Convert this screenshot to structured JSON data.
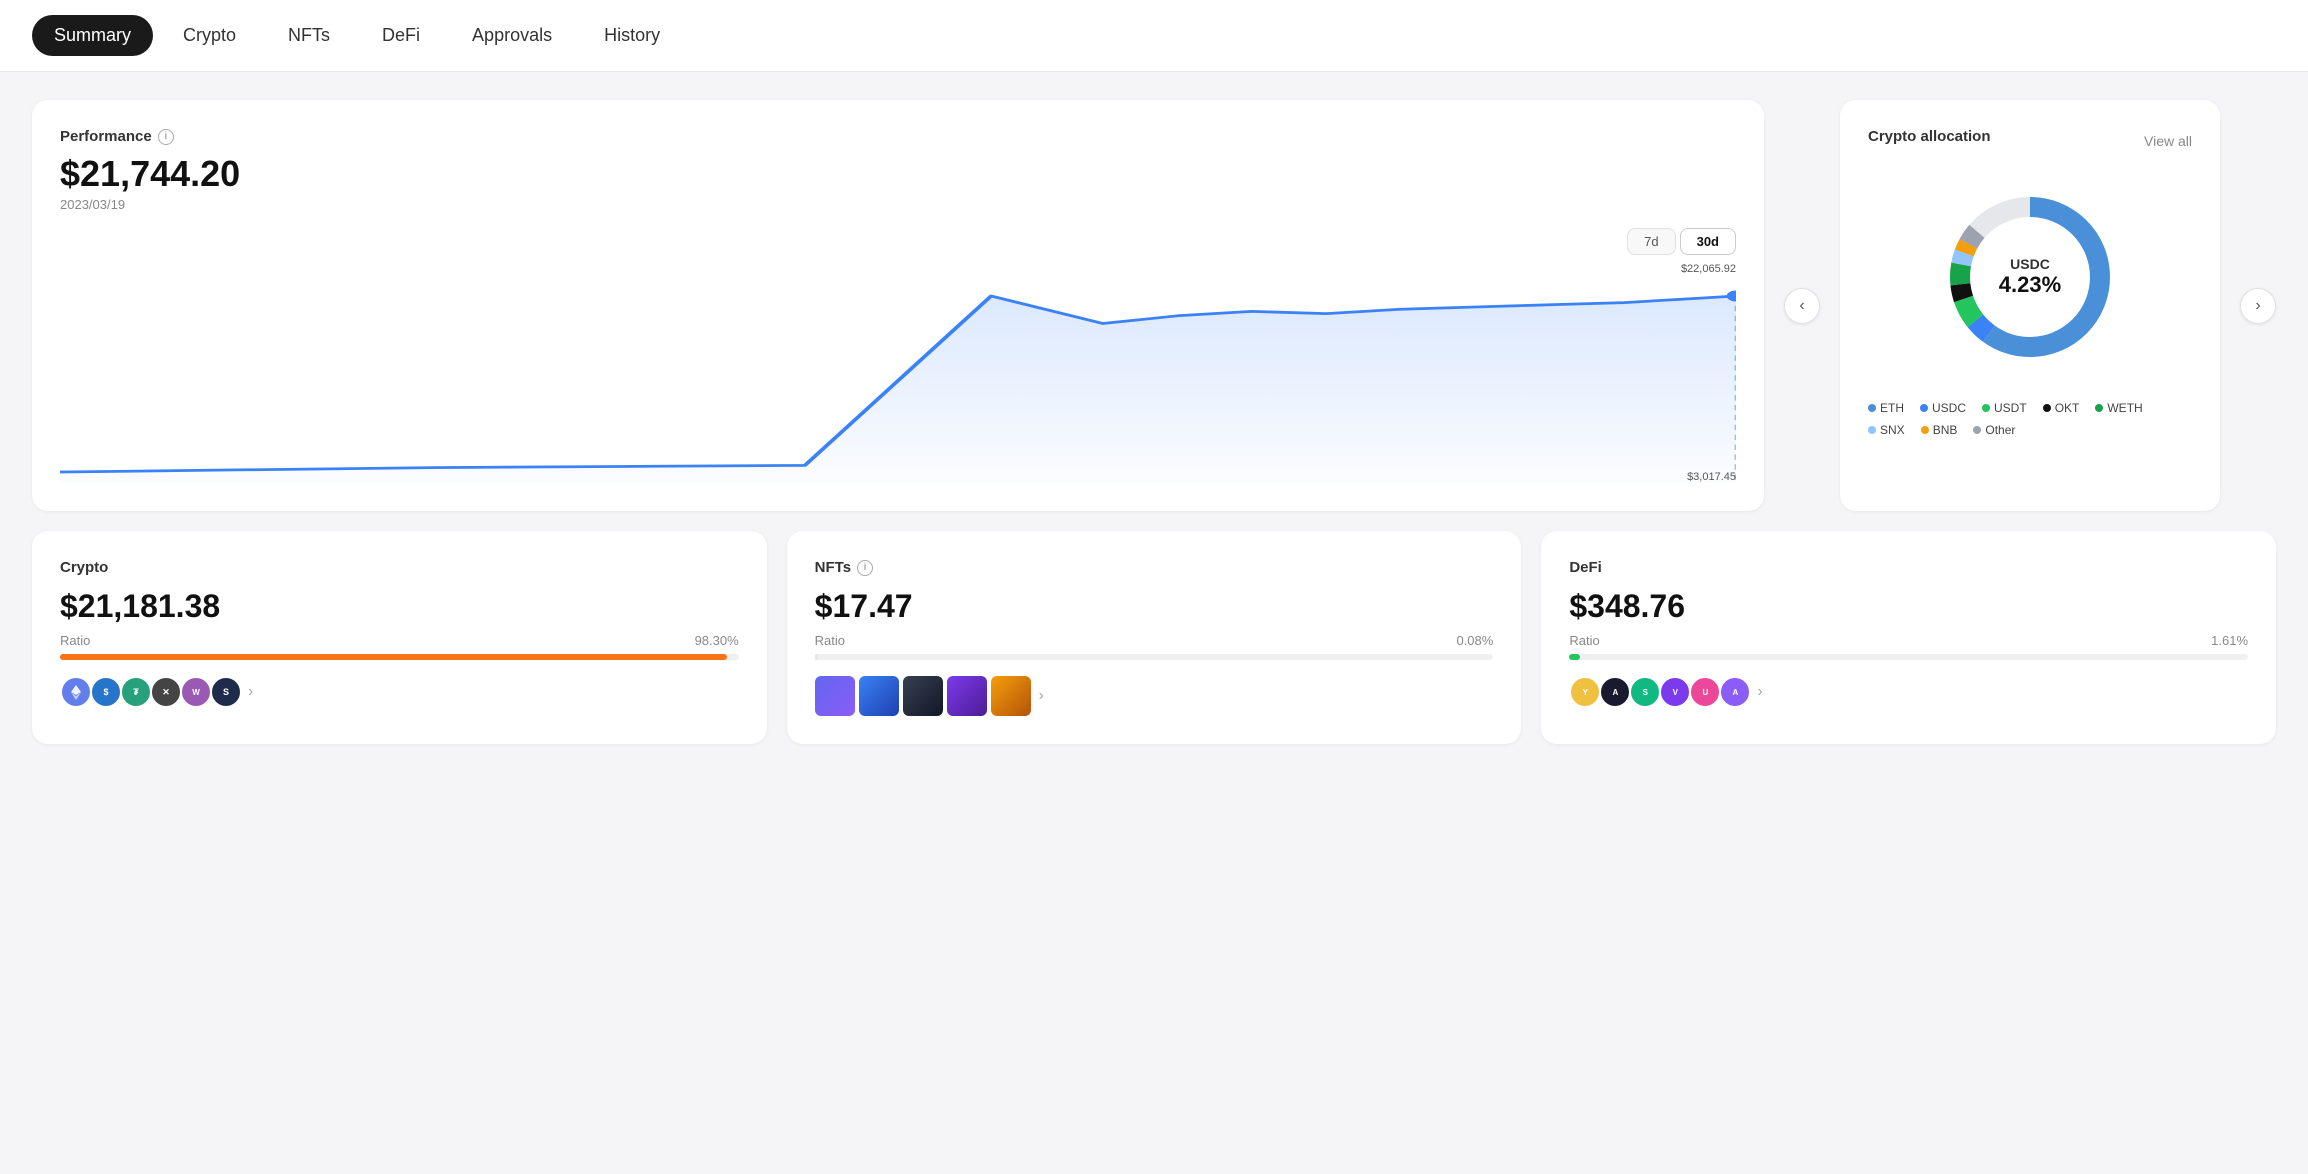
{
  "nav": {
    "items": [
      {
        "label": "Summary",
        "active": true
      },
      {
        "label": "Crypto",
        "active": false
      },
      {
        "label": "NFTs",
        "active": false
      },
      {
        "label": "DeFi",
        "active": false
      },
      {
        "label": "Approvals",
        "active": false
      },
      {
        "label": "History",
        "active": false
      }
    ]
  },
  "performance": {
    "title": "Performance",
    "value": "$21,744.20",
    "date": "2023/03/19",
    "high_label": "$22,065.92",
    "low_label": "$3,017.45",
    "time_buttons": [
      "7d",
      "30d"
    ],
    "active_time": "30d"
  },
  "allocation": {
    "title": "Crypto allocation",
    "view_all": "View all",
    "center_label": "USDC",
    "center_pct": "4.23%",
    "legend": [
      {
        "label": "ETH",
        "color": "#4a90d9"
      },
      {
        "label": "USDC",
        "color": "#3b82f6"
      },
      {
        "label": "USDT",
        "color": "#22c55e"
      },
      {
        "label": "OKT",
        "color": "#111111"
      },
      {
        "label": "WETH",
        "color": "#16a34a"
      },
      {
        "label": "SNX",
        "color": "#93c5fd"
      },
      {
        "label": "BNB",
        "color": "#f59e0b"
      },
      {
        "label": "Other",
        "color": "#9ca3af"
      }
    ]
  },
  "crypto_card": {
    "title": "Crypto",
    "value": "$21,181.38",
    "ratio_label": "Ratio",
    "ratio_pct": "98.30%",
    "bar_color": "#f97316",
    "bar_width": 98.3
  },
  "nfts_card": {
    "title": "NFTs",
    "value": "$17.47",
    "ratio_label": "Ratio",
    "ratio_pct": "0.08%",
    "bar_color": "#e5e7eb",
    "bar_width": 0.08
  },
  "defi_card": {
    "title": "DeFi",
    "value": "$348.76",
    "ratio_label": "Ratio",
    "ratio_pct": "1.61%",
    "bar_color": "#22c55e",
    "bar_width": 1.61
  },
  "icons": {
    "prev": "‹",
    "next": "›",
    "more": "›",
    "info": "i"
  }
}
